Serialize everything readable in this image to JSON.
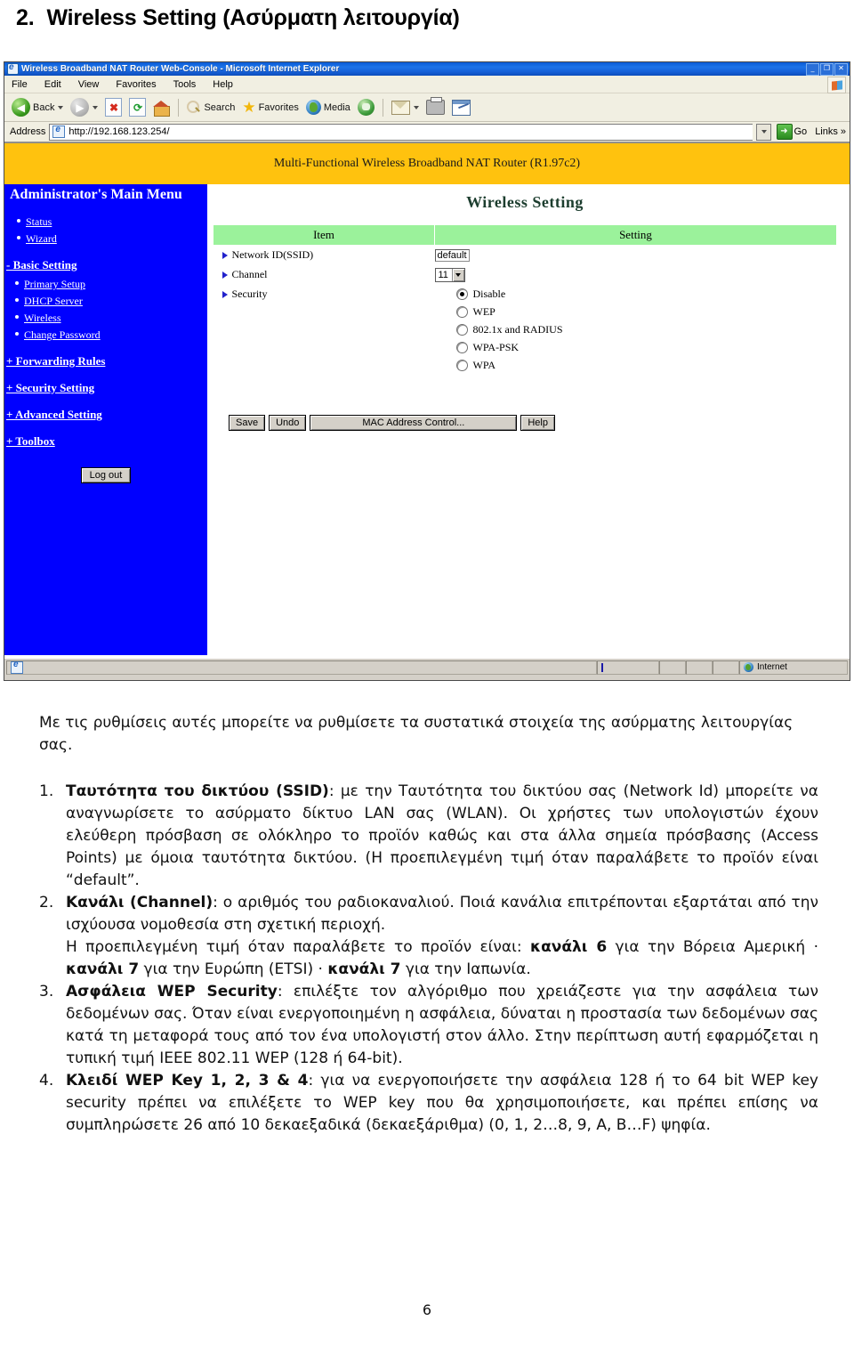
{
  "heading": {
    "number": "2.",
    "text": "Wireless Setting (Ασύρματη λειτουργία)"
  },
  "browser": {
    "title": "Wireless Broadband NAT Router Web-Console - Microsoft Internet Explorer",
    "window_buttons": {
      "minimize": "_",
      "restore": "❐",
      "close": "✕"
    },
    "menu": [
      "File",
      "Edit",
      "View",
      "Favorites",
      "Tools",
      "Help"
    ],
    "toolbar": {
      "back": "Back",
      "forward": "",
      "stop": "✖",
      "refresh": "⟳",
      "home": "",
      "search": "Search",
      "favorites": "Favorites",
      "media": "Media",
      "history": "",
      "mail": "",
      "print": "",
      "edit": ""
    },
    "address": {
      "label": "Address",
      "url": "http://192.168.123.254/",
      "go": "Go",
      "links": "Links",
      "links_chevron": "»"
    },
    "statusbar": {
      "zone": "Internet"
    }
  },
  "router": {
    "banner": "Multi-Functional Wireless Broadband NAT Router (R1.97c2)",
    "sidebar": {
      "title": "Administrator's Main Menu",
      "top_items": [
        {
          "label": "Status"
        },
        {
          "label": "Wizard"
        }
      ],
      "groups": [
        {
          "label": "- Basic Setting",
          "items": [
            {
              "label": "Primary Setup"
            },
            {
              "label": "DHCP Server"
            },
            {
              "label": "Wireless"
            },
            {
              "label": "Change Password"
            }
          ]
        },
        {
          "label": "+ Forwarding Rules",
          "items": []
        },
        {
          "label": "+ Security Setting",
          "items": []
        },
        {
          "label": "+ Advanced Setting",
          "items": []
        },
        {
          "label": "+ Toolbox",
          "items": []
        }
      ],
      "logout_label": "Log out"
    },
    "page_title": "Wireless Setting",
    "table": {
      "headers": [
        "Item",
        "Setting"
      ],
      "rows": [
        {
          "item": "Network ID(SSID)",
          "type": "text",
          "value": "default"
        },
        {
          "item": "Channel",
          "type": "select",
          "value": "11"
        },
        {
          "item": "Security",
          "type": "radio"
        }
      ]
    },
    "security_options": [
      {
        "label": "Disable",
        "checked": true
      },
      {
        "label": "WEP",
        "checked": false
      },
      {
        "label": "802.1x and RADIUS",
        "checked": false
      },
      {
        "label": "WPA-PSK",
        "checked": false
      },
      {
        "label": "WPA",
        "checked": false
      }
    ],
    "buttons": {
      "save": "Save",
      "undo": "Undo",
      "mac": "MAC Address Control...",
      "help": "Help"
    }
  },
  "document": {
    "intro": "Με τις ρυθμίσεις αυτές μπορείτε να ρυθμίσετε τα συστατικά στοιχεία της ασύρματης λειτουργίας σας.",
    "items": [
      {
        "marker": "1.",
        "bold_lead": "Ταυτότητα του δικτύου (SSID)",
        "rest": ": με την Ταυτότητα του δικτύου σας (Network Id) μπορείτε να αναγνωρίσετε το ασύρματο δίκτυο LAN σας (WLAN). Οι χρήστες των υπολογιστών έχουν ελεύθερη πρόσβαση σε ολόκληρο το προϊόν καθώς και στα άλλα σημεία πρόσβασης (Access Points) με όμοια ταυτότητα δικτύου. (Η προεπιλεγμένη τιμή όταν παραλάβετε το προϊόν είναι “default”."
      },
      {
        "marker": "2.",
        "bold_lead": "Κανάλι (Channel)",
        "rest": ": ο αριθμός του ραδιοκαναλιού. Ποιά κανάλια επιτρέπονται εξαρτάται από την ισχύουσα νομοθεσία στη σχετική περιοχή.",
        "line2_pre": "Η προεπιλεγμένη τιμή όταν παραλάβετε το προϊόν είναι: ",
        "line2_b1": "κανάλι 6",
        "line2_m1": " για την Βόρεια Αμερική · ",
        "line2_b2": "κανάλι 7",
        "line2_m2": " για την Ευρώπη (ETSI) · ",
        "line2_b3": "κανάλι 7",
        "line2_m3": " για την Ιαπωνία."
      },
      {
        "marker": "3.",
        "bold_lead": "Ασφάλεια WEP Security",
        "rest": ": επιλέξτε τον αλγόριθμο που χρειάζεστε για την ασφάλεια των δεδομένων σας. Όταν είναι ενεργοποιημένη η ασφάλεια, δύναται η προστασία των δεδομένων σας κατά τη μεταφορά τους από τον ένα υπολογιστή στον άλλο. Στην περίπτωση αυτή εφαρμόζεται η τυπική τιμή IEEE 802.11 WEP (128 ή 64-bit)."
      },
      {
        "marker": "4.",
        "bold_lead": "Κλειδί WEP Key 1, 2, 3 & 4",
        "rest": ": για να ενεργοποιήσετε την ασφάλεια 128 ή το 64 bit WEP key security πρέπει να επιλέξετε το WEP key που θα χρησιμοποιήσετε, και πρέπει επίσης να συμπληρώσετε 26 από 10 δεκαεξαδικά (δεκαεξάριθμα) (0, 1, 2…8, 9, Α, Β…F) ψηφία."
      }
    ],
    "page_number": "6"
  },
  "colors": {
    "banner_yellow": "#ffc20e",
    "sidebar_blue": "#0000ff",
    "table_header_green": "#9bf29b",
    "titlebar_blue": "#1d73e8"
  }
}
